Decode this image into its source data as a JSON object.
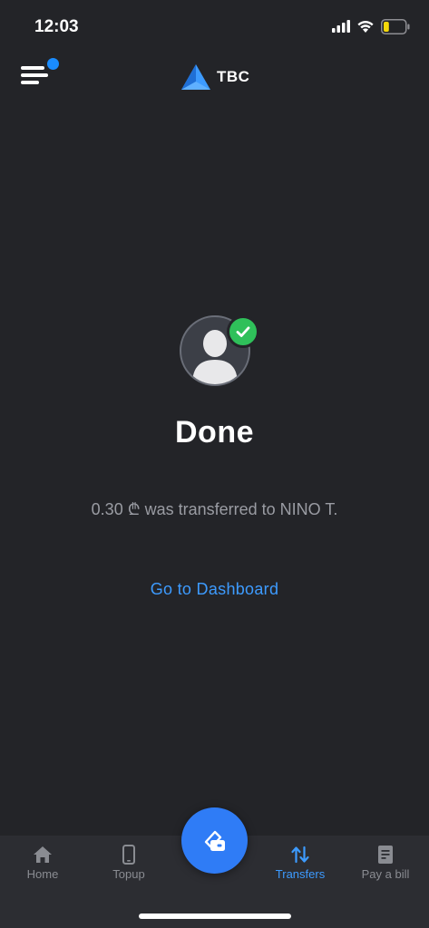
{
  "status_bar": {
    "time": "12:03",
    "battery_level": 0.25,
    "battery_color": "#f5d90a"
  },
  "header": {
    "brand_name": "TBC",
    "brand_color": "#3d9bff",
    "menu_icon": "hamburger-menu-icon",
    "notification_dot_color": "#1a8cff"
  },
  "result": {
    "title": "Done",
    "message": "0.30 ₾ was transferred to NINO T.",
    "link_label": "Go to Dashboard",
    "avatar_icon": "user-silhouette-icon",
    "badge_icon": "check-icon",
    "badge_color": "#2fc05a"
  },
  "tab_bar": {
    "tabs": [
      {
        "label": "Home",
        "icon": "home-icon",
        "active": false
      },
      {
        "label": "Topup",
        "icon": "phone-icon",
        "active": false
      },
      {
        "label": "Transfers",
        "icon": "transfer-arrows-icon",
        "active": true
      },
      {
        "label": "Pay a bill",
        "icon": "bill-icon",
        "active": false
      }
    ],
    "center_button_icon": "wallet-card-icon",
    "accent_color": "#3d9bff"
  }
}
